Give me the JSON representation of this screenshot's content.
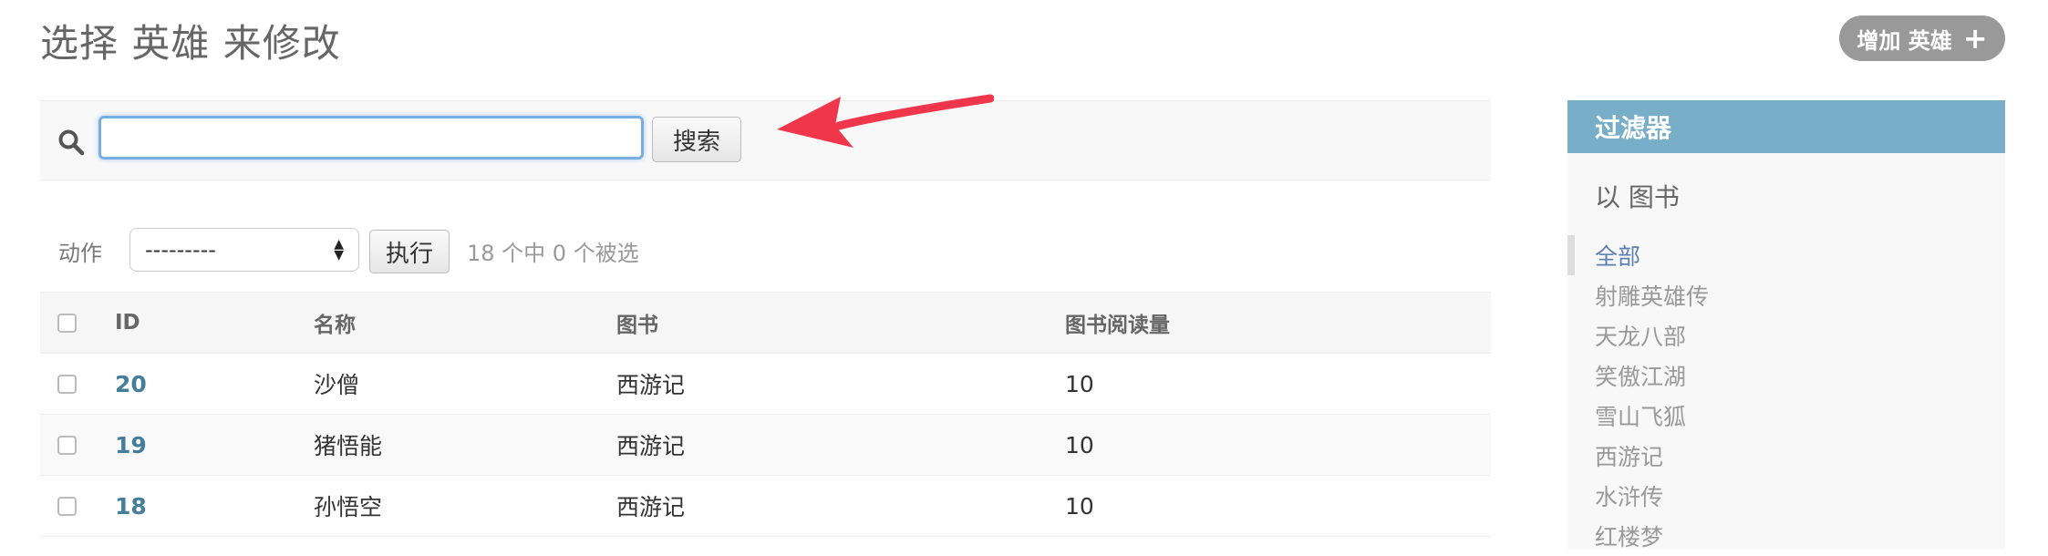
{
  "page": {
    "title": "选择 英雄 来修改",
    "add_button_label": "增加 英雄",
    "add_button_icon": "+"
  },
  "search": {
    "value": "",
    "placeholder": "",
    "button_label": "搜索"
  },
  "actions": {
    "label": "动作",
    "selected_option": "---------",
    "go_button_label": "执行",
    "selection_counter": "18 个中 0 个被选"
  },
  "table": {
    "columns": [
      "ID",
      "名称",
      "图书",
      "图书阅读量"
    ],
    "rows": [
      {
        "id": "20",
        "name": "沙僧",
        "book": "西游记",
        "reads": "10"
      },
      {
        "id": "19",
        "name": "猪悟能",
        "book": "西游记",
        "reads": "10"
      },
      {
        "id": "18",
        "name": "孙悟空",
        "book": "西游记",
        "reads": "10"
      }
    ]
  },
  "filter": {
    "title": "过滤器",
    "section_title": "以 图书",
    "items": [
      "全部",
      "射雕英雄传",
      "天龙八部",
      "笑傲江湖",
      "雪山飞狐",
      "西游记",
      "水浒传",
      "红楼梦"
    ],
    "selected_item": "全部"
  },
  "colors": {
    "accent": "#79aec8",
    "link": "#447e9b",
    "annotation_arrow": "#f0364a"
  }
}
